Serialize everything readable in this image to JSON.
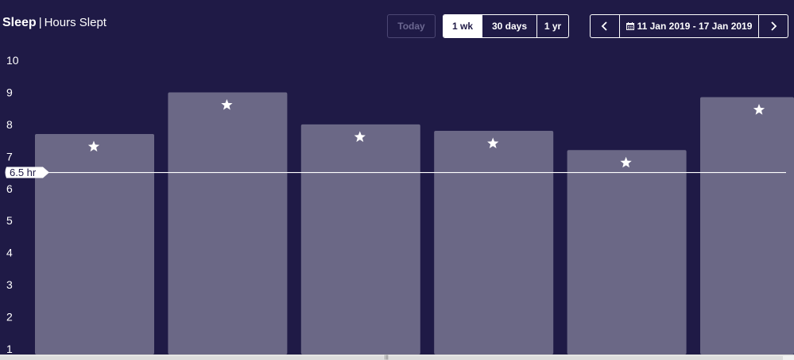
{
  "header": {
    "title": "Sleep",
    "separator": "|",
    "subtitle": "Hours Slept"
  },
  "controls": {
    "today_label": "Today",
    "ranges": [
      {
        "label": "1 wk",
        "active": true
      },
      {
        "label": "30 days",
        "active": false
      },
      {
        "label": "1 yr",
        "active": false
      }
    ],
    "prev_label": "‹",
    "next_label": "›",
    "date_range": "11 Jan 2019 - 17 Jan 2019"
  },
  "colors": {
    "background": "#1f1a46",
    "bar": "#6b6886",
    "goal_line": "#ffffff",
    "text": "#ffffff"
  },
  "chart_data": {
    "type": "bar",
    "title": "Hours Slept",
    "xlabel": "",
    "ylabel": "",
    "ylim": [
      1,
      10
    ],
    "yticks": [
      1,
      2,
      3,
      4,
      5,
      6,
      7,
      8,
      9,
      10
    ],
    "values": [
      7.7,
      9.0,
      8.0,
      7.8,
      7.2,
      8.85
    ],
    "markers": "star",
    "goal": {
      "value": 6.5,
      "label": "6.5 hr"
    },
    "grid": false,
    "legend": "none"
  }
}
